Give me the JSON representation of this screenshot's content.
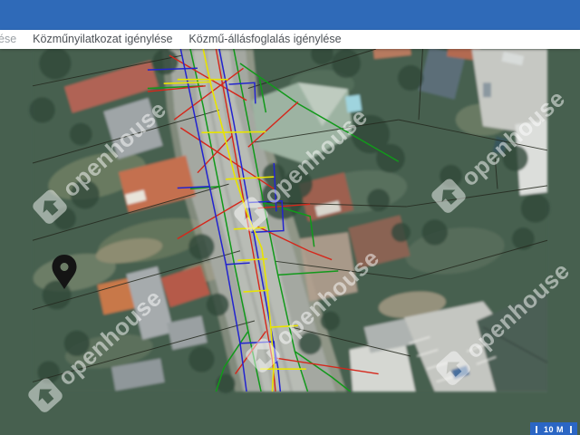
{
  "header": {
    "nav": [
      {
        "label": "ése"
      },
      {
        "label": "Közműnyilatkozat igénylése"
      },
      {
        "label": "Közmű-állásfoglalás igénylése"
      }
    ]
  },
  "map": {
    "watermark_text": "openhouse",
    "scale_badge": {
      "label": "10 M"
    },
    "colors": {
      "header_blue": "#2f6ab8",
      "scale_badge_blue": "#2b66c4",
      "utility_green": "#12991b",
      "utility_yellow": "#e8e400",
      "utility_blue": "#2324cf",
      "utility_red": "#d5271b",
      "parcel_line": "#24291f",
      "pin_color": "#141414",
      "watermark_white": "#ffffff"
    }
  }
}
